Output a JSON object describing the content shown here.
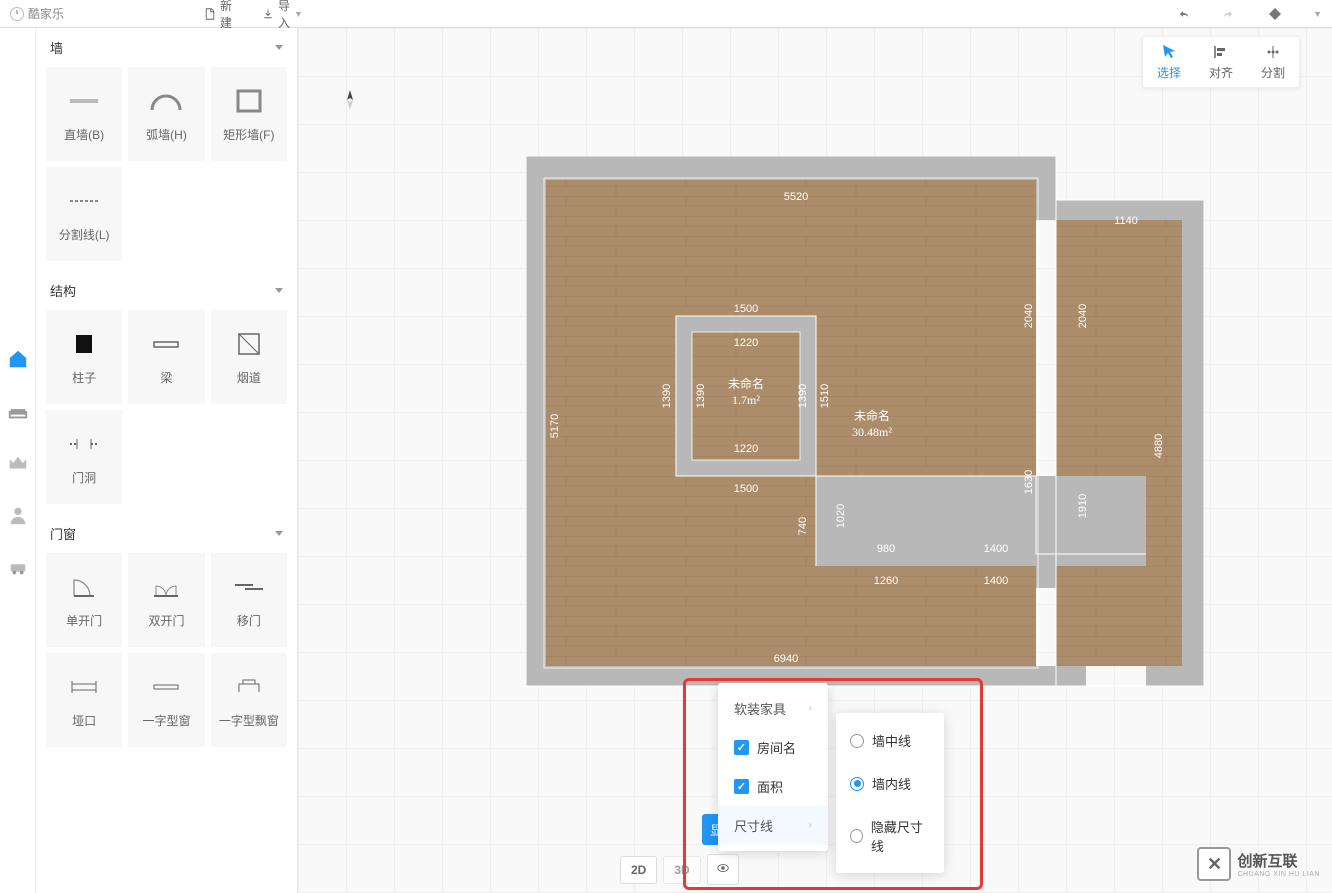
{
  "brand": "酷家乐",
  "topbar": {
    "new": "新建",
    "import": "导入"
  },
  "sidebar": {
    "sections": [
      {
        "title": "墙",
        "tools": [
          "直墙(B)",
          "弧墙(H)",
          "矩形墙(F)",
          "分割线(L)"
        ]
      },
      {
        "title": "结构",
        "tools": [
          "柱子",
          "梁",
          "烟道",
          "门洞"
        ]
      },
      {
        "title": "门窗",
        "tools": [
          "单开门",
          "双开门",
          "移门",
          "垭口",
          "一字型窗",
          "一字型飘窗"
        ]
      }
    ]
  },
  "mode_toolbar": {
    "select": "选择",
    "align": "对齐",
    "split": "分割"
  },
  "floorplan": {
    "room1": {
      "name": "未命名",
      "area": "1.7m²"
    },
    "room2": {
      "name": "未命名",
      "area": "30.48m²"
    },
    "dims": {
      "top": "5520",
      "topright": "1140",
      "leftv": "5170",
      "bottom": "6940",
      "innerTop": "1500",
      "innerTopSmall": "1220",
      "innerLeft": "1390",
      "innerLeftSmall": "1390",
      "innerBottom": "1500",
      "innerBottomSmall": "1220",
      "innerRight": "1510",
      "midBottom": "740",
      "lowMid": "980",
      "lowRight": "1400",
      "vlowRight": "1400",
      "vlowLeft": "1260",
      "rightMid": "1630",
      "rightTop": "2040",
      "farRightTop": "2040",
      "farRight": "4880",
      "farRightMid": "1910",
      "innerV": "1020"
    }
  },
  "popup1": {
    "furniture": "软装家具",
    "roomname": "房间名",
    "area": "面积",
    "dimline": "尺寸线"
  },
  "popup2": {
    "mid": "墙中线",
    "inner": "墙内线",
    "hide": "隐藏尺寸线"
  },
  "display_btn": "显",
  "bottom": {
    "2d": "2D",
    "3d": "3D"
  },
  "watermark": {
    "name": "创新互联",
    "sub": "CHUANG XIN HU LIAN"
  }
}
